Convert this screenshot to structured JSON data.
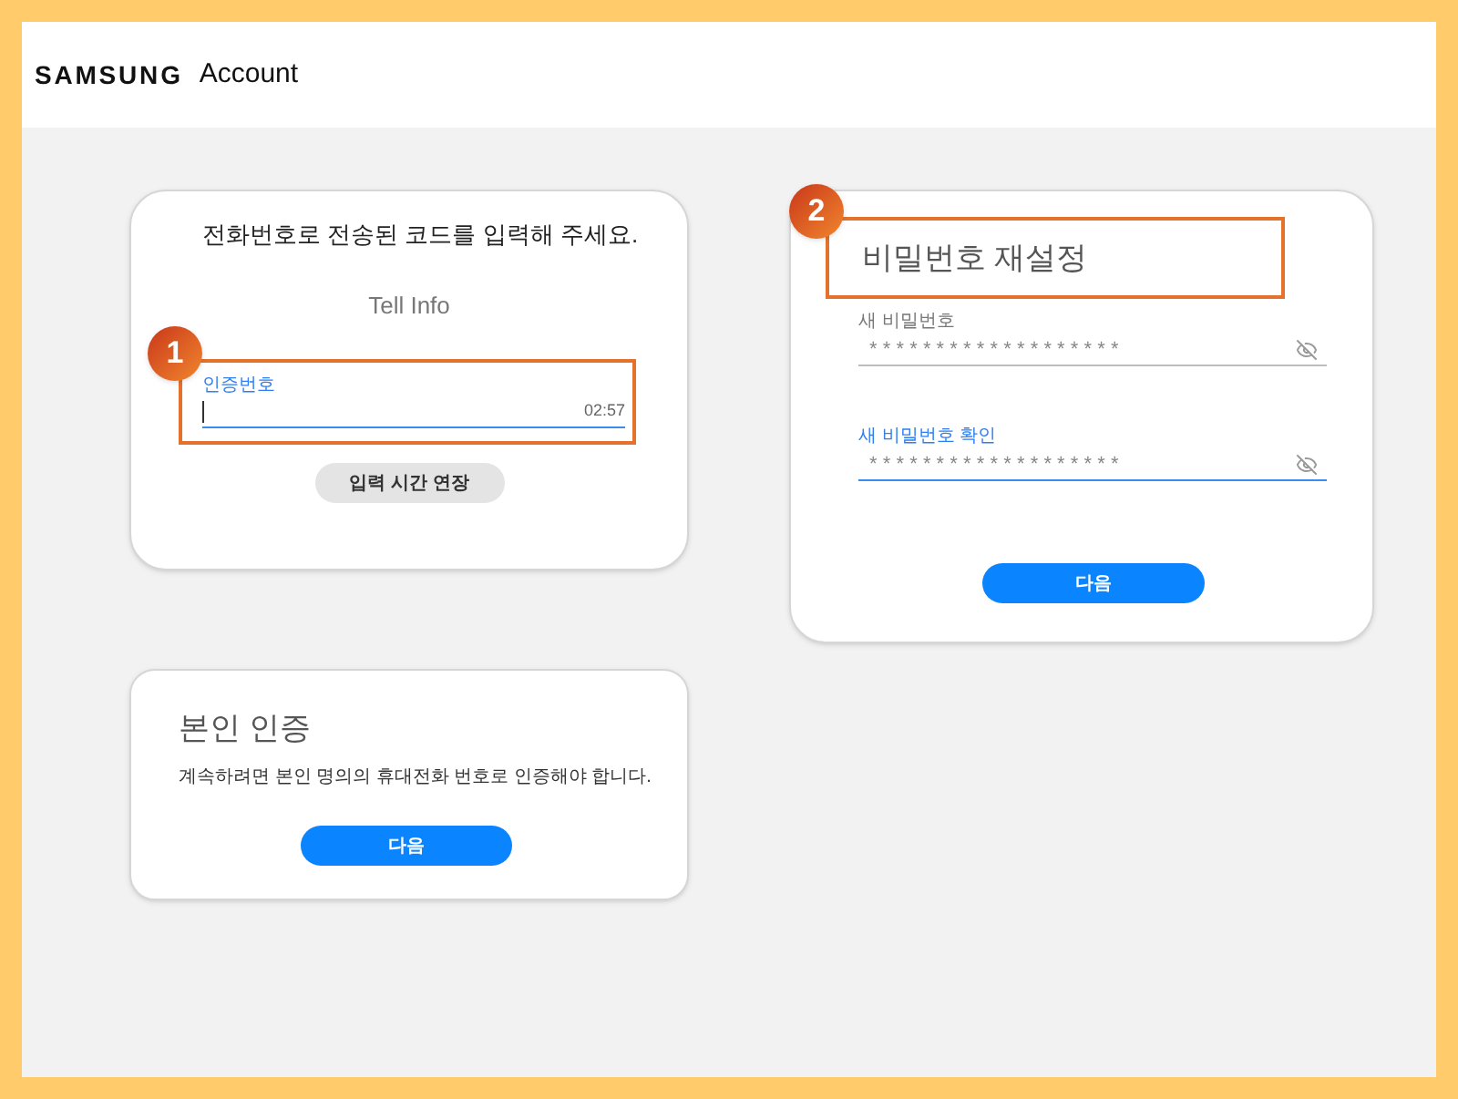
{
  "header": {
    "logo": "SAMSUNG",
    "title": "Account"
  },
  "code_card": {
    "callout": "1",
    "heading": "전화번호로 전송된 코드를 입력해 주세요.",
    "subtitle": "Tell Info",
    "field": {
      "label": "인증번호",
      "focused": true,
      "timer": "02:57"
    },
    "button": "입력 시간 연장"
  },
  "reset_card": {
    "callout": "2",
    "title": "비밀번호 재설정",
    "fields": [
      {
        "label": "새 비밀번호",
        "value": "*******************",
        "focused": false
      },
      {
        "label": "새 비밀번호 확인",
        "value": "*******************",
        "focused": true
      }
    ],
    "button": "다음"
  },
  "verify_card": {
    "title": "본인 인증",
    "text": "계속하려면 본인 명의의 휴대전화 번호로 인증해야 합니다.",
    "button": "다음"
  }
}
